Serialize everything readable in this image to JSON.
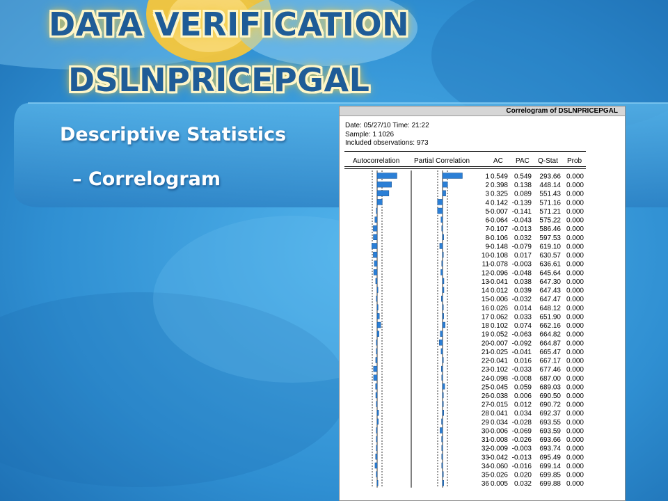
{
  "slide": {
    "title_line1": "DATA VERIFICATION",
    "title_line2": "DSLNPRICEPGAL",
    "bullets": [
      "Descriptive Statistics",
      "– Correlogram"
    ]
  },
  "colors": {
    "background": "#2a86c8",
    "title_fill": "#1f5c97",
    "title_glow": "#f2c53a",
    "bar": "#2b7fd6"
  },
  "window": {
    "title": "Correlogram of DSLNPRICEPGAL",
    "date_line": "Date: 05/27/10   Time: 21:22",
    "sample_line": "Sample: 1 1026",
    "obs_line": "Included observations: 973",
    "headers": {
      "autocorrelation": "Autocorrelation",
      "partial_correlation": "Partial Correlation",
      "ac": "AC",
      "pac": "PAC",
      "qstat": "Q-Stat",
      "prob": "Prob"
    },
    "rows": [
      [
        "1",
        "0.549",
        "0.549",
        "293.66",
        "0.000"
      ],
      [
        "2",
        "0.398",
        "0.138",
        "448.14",
        "0.000"
      ],
      [
        "3",
        "0.325",
        "0.089",
        "551.43",
        "0.000"
      ],
      [
        "4",
        "0.142",
        "-0.139",
        "571.16",
        "0.000"
      ],
      [
        "5",
        "-0.007",
        "-0.141",
        "571.21",
        "0.000"
      ],
      [
        "6",
        "-0.064",
        "-0.043",
        "575.22",
        "0.000"
      ],
      [
        "7",
        "-0.107",
        "-0.013",
        "586.46",
        "0.000"
      ],
      [
        "8",
        "-0.106",
        "0.032",
        "597.53",
        "0.000"
      ],
      [
        "9",
        "-0.148",
        "-0.079",
        "619.10",
        "0.000"
      ],
      [
        "10",
        "-0.108",
        "0.017",
        "630.57",
        "0.000"
      ],
      [
        "11",
        "-0.078",
        "-0.003",
        "636.61",
        "0.000"
      ],
      [
        "12",
        "-0.096",
        "-0.048",
        "645.64",
        "0.000"
      ],
      [
        "13",
        "-0.041",
        "0.038",
        "647.30",
        "0.000"
      ],
      [
        "14",
        "0.012",
        "0.039",
        "647.43",
        "0.000"
      ],
      [
        "15",
        "-0.006",
        "-0.032",
        "647.47",
        "0.000"
      ],
      [
        "16",
        "0.026",
        "0.014",
        "648.12",
        "0.000"
      ],
      [
        "17",
        "0.062",
        "0.033",
        "651.90",
        "0.000"
      ],
      [
        "18",
        "0.102",
        "0.074",
        "662.16",
        "0.000"
      ],
      [
        "19",
        "0.052",
        "-0.063",
        "664.82",
        "0.000"
      ],
      [
        "20",
        "-0.007",
        "-0.092",
        "664.87",
        "0.000"
      ],
      [
        "21",
        "-0.025",
        "-0.041",
        "665.47",
        "0.000"
      ],
      [
        "22",
        "-0.041",
        "0.016",
        "667.17",
        "0.000"
      ],
      [
        "23",
        "-0.102",
        "-0.033",
        "677.46",
        "0.000"
      ],
      [
        "24",
        "-0.098",
        "-0.008",
        "687.00",
        "0.000"
      ],
      [
        "25",
        "-0.045",
        "0.059",
        "689.03",
        "0.000"
      ],
      [
        "26",
        "-0.038",
        "0.006",
        "690.50",
        "0.000"
      ],
      [
        "27",
        "-0.015",
        "0.012",
        "690.72",
        "0.000"
      ],
      [
        "28",
        "0.041",
        "0.034",
        "692.37",
        "0.000"
      ],
      [
        "29",
        "0.034",
        "-0.028",
        "693.55",
        "0.000"
      ],
      [
        "30",
        "-0.006",
        "-0.069",
        "693.59",
        "0.000"
      ],
      [
        "31",
        "-0.008",
        "-0.026",
        "693.66",
        "0.000"
      ],
      [
        "32",
        "-0.009",
        "-0.003",
        "693.74",
        "0.000"
      ],
      [
        "33",
        "-0.042",
        "-0.013",
        "695.49",
        "0.000"
      ],
      [
        "34",
        "-0.060",
        "-0.016",
        "699.14",
        "0.000"
      ],
      [
        "35",
        "-0.026",
        "0.020",
        "699.85",
        "0.000"
      ],
      [
        "36",
        "0.005",
        "0.032",
        "699.88",
        "0.000"
      ]
    ]
  }
}
